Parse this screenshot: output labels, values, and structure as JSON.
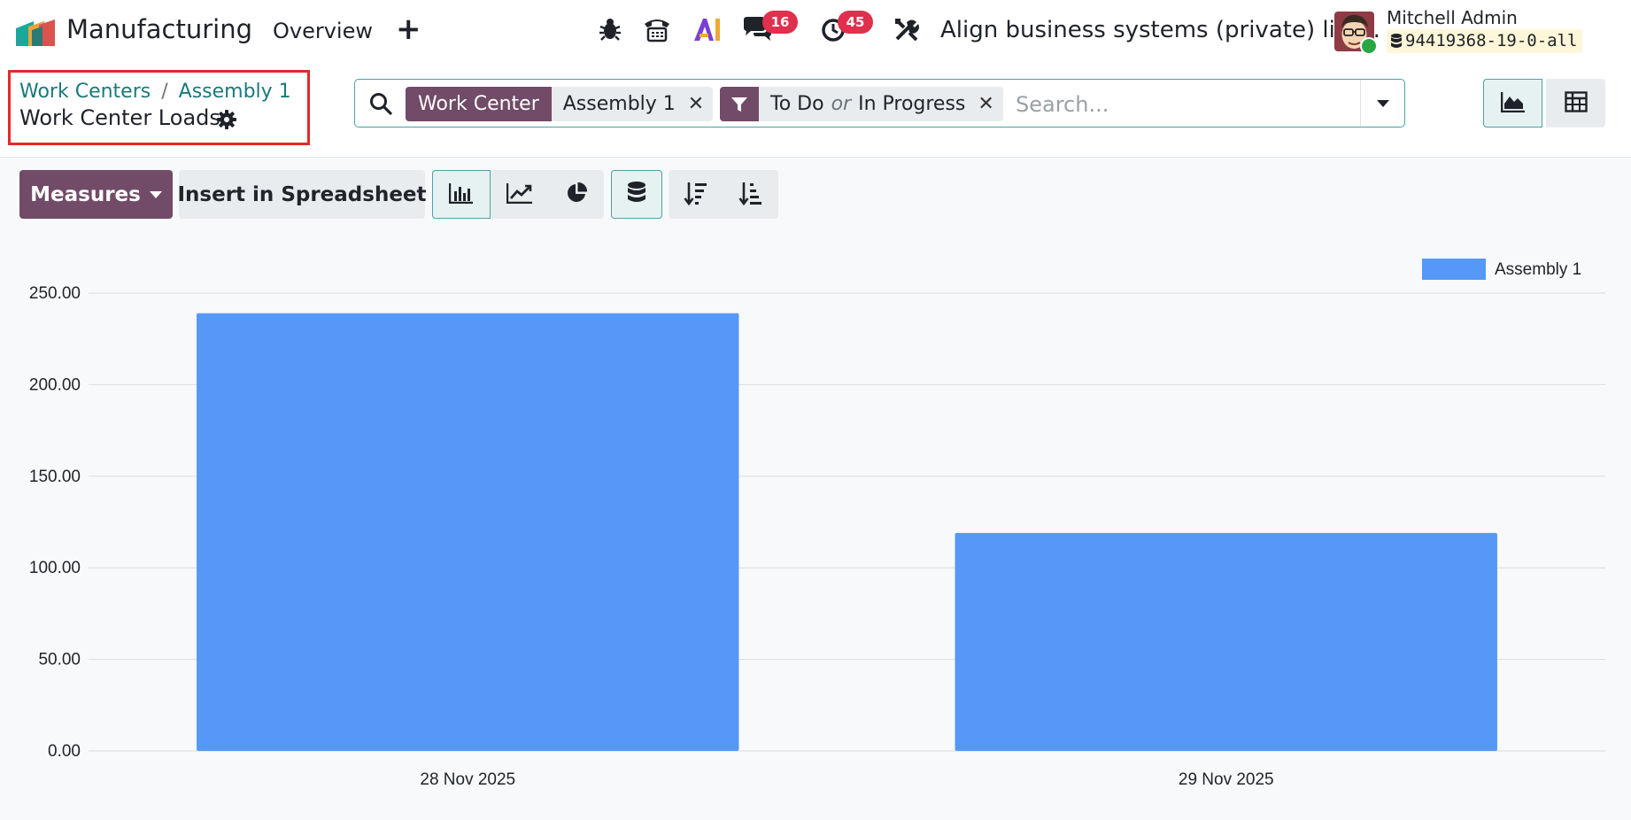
{
  "navbar": {
    "app_name": "Manufacturing",
    "menu_overview": "Overview",
    "messages_count": "16",
    "activities_count": "45",
    "company": "Align business systems (private) lim…",
    "user_name": "Mitchell Admin",
    "database": "94419368-19-0-all"
  },
  "breadcrumb": {
    "items": [
      "Work Centers",
      "Assembly 1"
    ],
    "separator": "/",
    "current": "Work Center Loads"
  },
  "search": {
    "facets": [
      {
        "label": "Work Center",
        "value": "Assembly 1"
      },
      {
        "values": [
          "To Do",
          "In Progress"
        ],
        "joiner": "or"
      }
    ],
    "placeholder": "Search..."
  },
  "toolbar": {
    "measures_label": "Measures",
    "insert_label": "Insert in Spreadsheet"
  },
  "colors": {
    "brand": "#714b67",
    "accent": "#1a7a7a",
    "bar": "#5598f5",
    "badge": "#e0304d"
  },
  "chart_data": {
    "type": "bar",
    "categories": [
      "28 Nov 2025",
      "29 Nov 2025"
    ],
    "series": [
      {
        "name": "Assembly 1",
        "values": [
          239,
          119
        ]
      }
    ],
    "ylim": [
      0,
      250
    ],
    "yticks": [
      "0.00",
      "50.00",
      "100.00",
      "150.00",
      "200.00",
      "250.00"
    ],
    "grid": true,
    "legend": "top-right"
  }
}
